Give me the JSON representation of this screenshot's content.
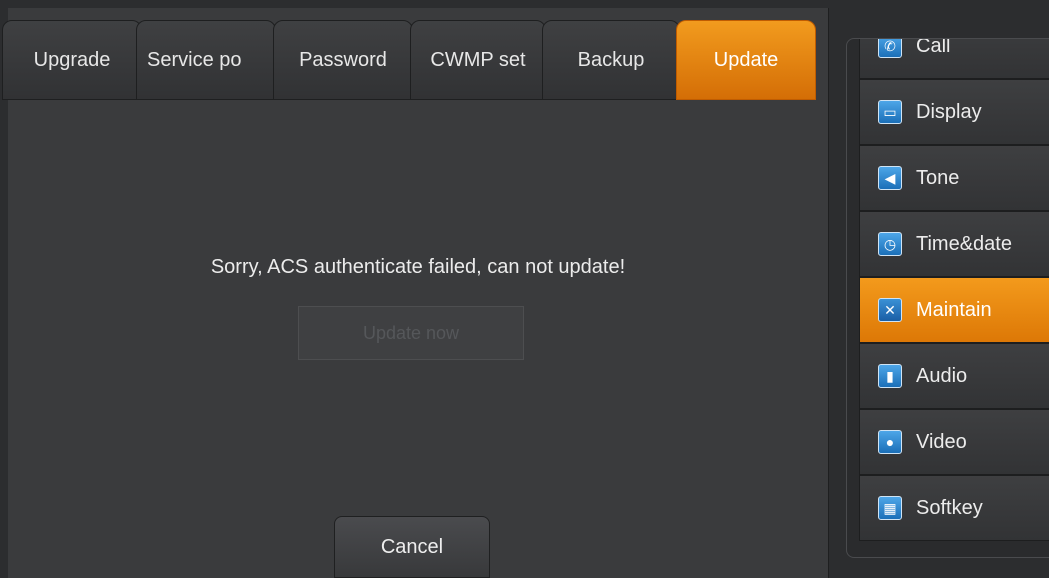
{
  "tabs": [
    {
      "label": "Upgrade"
    },
    {
      "label": "Service po"
    },
    {
      "label": "Password"
    },
    {
      "label": "CWMP set"
    },
    {
      "label": "Backup"
    },
    {
      "label": "Update"
    }
  ],
  "content": {
    "message": "Sorry, ACS authenticate failed, can not update!",
    "update_button": "Update now",
    "cancel_button": "Cancel"
  },
  "sidebar": {
    "items": [
      {
        "label": "Call",
        "icon": "phone-icon"
      },
      {
        "label": "Display",
        "icon": "monitor-icon"
      },
      {
        "label": "Tone",
        "icon": "speaker-icon"
      },
      {
        "label": "Time&date",
        "icon": "clock-icon"
      },
      {
        "label": "Maintain",
        "icon": "tools-icon"
      },
      {
        "label": "Audio",
        "icon": "microphone-icon"
      },
      {
        "label": "Video",
        "icon": "camera-icon"
      },
      {
        "label": "Softkey",
        "icon": "keypad-icon"
      }
    ]
  },
  "colors": {
    "accent": "#e8850f",
    "background": "#3a3b3d"
  }
}
